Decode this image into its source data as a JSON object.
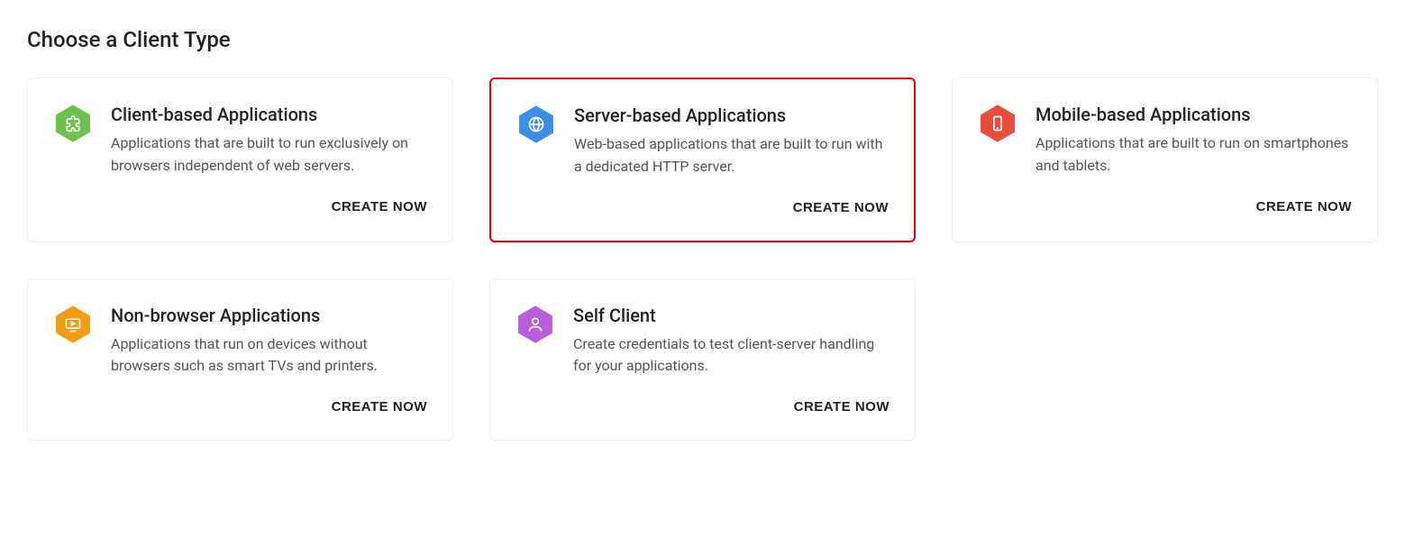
{
  "title": "Choose a Client Type",
  "create_label": "CREATE NOW",
  "cards": [
    {
      "id": "client-based",
      "title": "Client-based Applications",
      "desc": "Applications that are built to run exclusively on browsers independent of web servers.",
      "icon": "puzzle-icon",
      "color": "#6cc24a",
      "highlighted": false
    },
    {
      "id": "server-based",
      "title": "Server-based Applications",
      "desc": "Web-based applications that are built to run with a dedicated HTTP server.",
      "icon": "globe-icon",
      "color": "#3b8fe6",
      "highlighted": true
    },
    {
      "id": "mobile-based",
      "title": "Mobile-based Applications",
      "desc": "Applications that are built to run on smartphones and tablets.",
      "icon": "mobile-icon",
      "color": "#e84c3d",
      "highlighted": false
    },
    {
      "id": "non-browser",
      "title": "Non-browser Applications",
      "desc": "Applications that run on devices without browsers such as smart TVs and printers.",
      "icon": "tv-icon",
      "color": "#f39c12",
      "highlighted": false
    },
    {
      "id": "self-client",
      "title": "Self Client",
      "desc": "Create credentials to test client-server handling for your applications.",
      "icon": "person-icon",
      "color": "#b95dd8",
      "highlighted": false
    }
  ]
}
